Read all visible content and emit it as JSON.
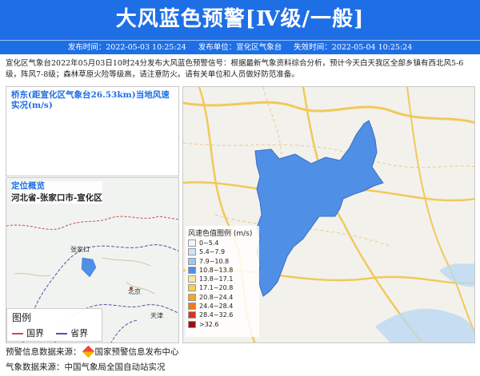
{
  "header": {
    "title": "大风蓝色预警[Ⅳ级/一般]"
  },
  "meta": {
    "publish_time": "发布时间：2022-05-03 10:25:24",
    "publisher": "发布单位：宣化区气象台",
    "expire_time": "失效时间：2022-05-04 10:25:24"
  },
  "description": "宣化区气象台2022年05月03日10时24分发布大风蓝色预警信号：根据最新气象资料综合分析，预计今天白天我区全部乡镇有西北风5-6级，阵风7-8级；森林草原火险等级高，请注意防火。请有关单位和人员做好防范准备。",
  "station_panel": {
    "title": "桥东(距宣化区气象台26.53km)当地风速实况(m/s)"
  },
  "locate_panel": {
    "title": "定位概览",
    "location": "河北省-张家口市-宣化区",
    "legend_title": "图例",
    "legend_items": [
      "国界",
      "省界"
    ],
    "map_labels": [
      "北京",
      "天津",
      "张家口"
    ]
  },
  "wind_legend": {
    "title": "风速色值图例 (m/s)",
    "items": [
      {
        "label": "0~5.4",
        "color": "#f0f4fb"
      },
      {
        "label": "5.4~7.9",
        "color": "#cfe3f7"
      },
      {
        "label": "7.9~10.8",
        "color": "#9fc8f0"
      },
      {
        "label": "10.8~13.8",
        "color": "#4f8fe6"
      },
      {
        "label": "13.8~17.1",
        "color": "#f6ea9a"
      },
      {
        "label": "17.1~20.8",
        "color": "#f5d24a"
      },
      {
        "label": "20.8~24.4",
        "color": "#f5a623"
      },
      {
        "label": "24.4~28.4",
        "color": "#ef7a1a"
      },
      {
        "label": "28.4~32.6",
        "color": "#d9341c"
      },
      {
        "label": ">32.6",
        "color": "#9b1010"
      }
    ]
  },
  "footer": {
    "warning_source_label": "预警信息数据来源：",
    "warning_source": "国家预警信息发布中心",
    "weather_source": "气象数据来源：中国气象局全国自动站实况"
  },
  "colors": {
    "banner": "#1e6fe6",
    "warning_area": "#4f8fe6"
  }
}
